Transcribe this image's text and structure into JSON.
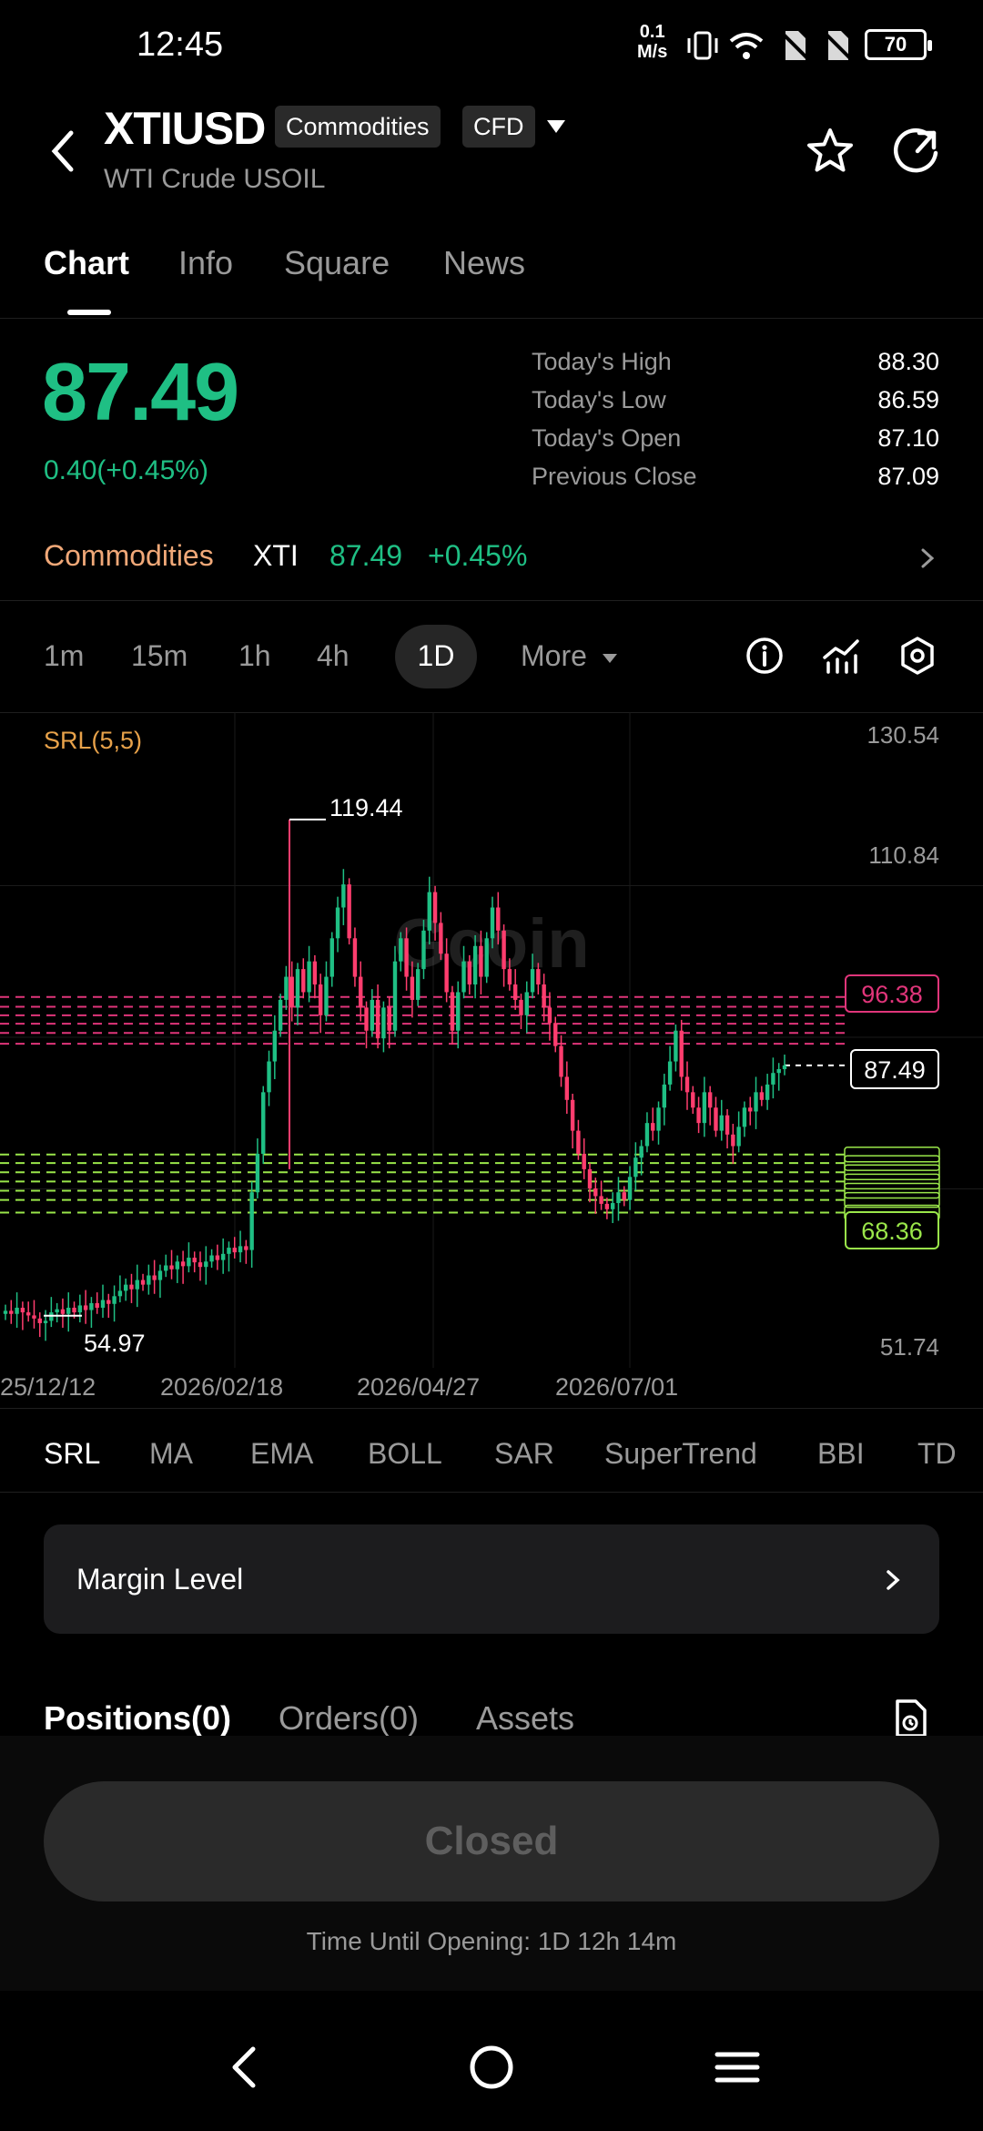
{
  "status_bar": {
    "time": "12:45",
    "net_speed_value": "0.1",
    "net_speed_unit": "M/s",
    "battery": "70",
    "icons": [
      "vibrate-icon",
      "wifi-icon",
      "no-sim-icon",
      "no-sim-icon",
      "battery-icon"
    ]
  },
  "header": {
    "symbol": "XTIUSD",
    "tags": [
      "Commodities",
      "CFD"
    ],
    "subtitle": "WTI Crude USOIL"
  },
  "tabs": [
    {
      "label": "Chart",
      "active": true
    },
    {
      "label": "Info",
      "active": false
    },
    {
      "label": "Square",
      "active": false
    },
    {
      "label": "News",
      "active": false
    }
  ],
  "quote": {
    "price": "87.49",
    "change": "0.40(+0.45%)",
    "stats": [
      {
        "label": "Today's High",
        "value": "88.30"
      },
      {
        "label": "Today's Low",
        "value": "86.59"
      },
      {
        "label": "Today's Open",
        "value": "87.10"
      },
      {
        "label": "Previous Close",
        "value": "87.09"
      }
    ]
  },
  "ticker": {
    "category": "Commodities",
    "symbol": "XTI",
    "price": "87.49",
    "change": "+0.45%"
  },
  "timeframes": {
    "items": [
      "1m",
      "15m",
      "1h",
      "4h",
      "1D"
    ],
    "selected": "1D",
    "more_label": "More"
  },
  "indicators": {
    "items": [
      "SRL",
      "MA",
      "EMA",
      "BOLL",
      "SAR",
      "SuperTrend",
      "BBI",
      "TD"
    ],
    "selected": "SRL"
  },
  "chart_data": {
    "type": "candlestick",
    "indicator_label": "SRL(5,5)",
    "watermark": "Gcoin",
    "y_ticks": [
      "130.54",
      "110.84",
      "51.74"
    ],
    "y_range": [
      51.74,
      130.54
    ],
    "x_ticks": [
      "25/12/12",
      "2026/02/18",
      "2026/04/27",
      "2026/07/01"
    ],
    "high_marker": "119.44",
    "low_marker": "54.97",
    "resistance_badge": "96.38",
    "current_badge": "87.49",
    "support_badge": "68.36",
    "resistance_levels": [
      96.38,
      95.1,
      94.0,
      92.9,
      91.7,
      90.3
    ],
    "support_levels": [
      75.9,
      74.8,
      73.6,
      72.4,
      71.2,
      70.0,
      68.36
    ],
    "closes": [
      55.6,
      55.2,
      56.0,
      55.4,
      55.0,
      54.6,
      54.0,
      54.3,
      55.4,
      55.8,
      55.2,
      56.0,
      55.4,
      56.3,
      55.7,
      56.6,
      56.0,
      57.0,
      56.5,
      57.5,
      58.2,
      59.0,
      58.4,
      59.6,
      59.0,
      60.2,
      59.6,
      60.8,
      61.5,
      61.0,
      62.0,
      61.4,
      62.5,
      61.9,
      61.3,
      62.0,
      62.8,
      62.2,
      63.0,
      63.8,
      63.2,
      64.0,
      63.5,
      71.0,
      76.0,
      84.0,
      88.0,
      92.0,
      96.0,
      99.0,
      95.0,
      100.0,
      97.0,
      101.0,
      98.0,
      94.0,
      99.0,
      104.0,
      108.0,
      111.0,
      104.0,
      99.0,
      95.0,
      92.0,
      96.0,
      91.0,
      95.0,
      92.0,
      101.0,
      104.0,
      99.0,
      96.0,
      100.0,
      105.0,
      110.0,
      106.0,
      102.0,
      97.0,
      92.0,
      97.0,
      101.0,
      98.0,
      103.0,
      99.0,
      104.0,
      108.0,
      105.0,
      100.0,
      98.0,
      96.0,
      94.0,
      97.0,
      100.0,
      98.0,
      95.0,
      93.0,
      90.0,
      86.0,
      83.0,
      79.0,
      76.0,
      74.0,
      71.5,
      70.5,
      69.5,
      68.8,
      69.6,
      71.0,
      70.0,
      73.0,
      75.5,
      77.0,
      80.0,
      79.0,
      82.0,
      85.0,
      88.0,
      92.0,
      86.0,
      84.0,
      82.0,
      80.0,
      84.0,
      82.0,
      79.0,
      81.0,
      78.5,
      77.0,
      79.5,
      82.0,
      81.5,
      84.0,
      83.0,
      85.0,
      86.5,
      87.0,
      87.49
    ]
  },
  "margin_level": {
    "label": "Margin Level"
  },
  "position_tabs": [
    {
      "label": "Positions(0)",
      "active": true
    },
    {
      "label": "Orders(0)",
      "active": false
    },
    {
      "label": "Assets",
      "active": false
    }
  ],
  "trade": {
    "closed_label": "Closed",
    "opening_text": "Time Until Opening: 1D 12h 14m"
  },
  "colors": {
    "up": "#1fbf84",
    "down": "#ff3d6e",
    "resistance": "#e0357a",
    "support": "#9ae64a",
    "indicator_label": "#e8a24a"
  }
}
